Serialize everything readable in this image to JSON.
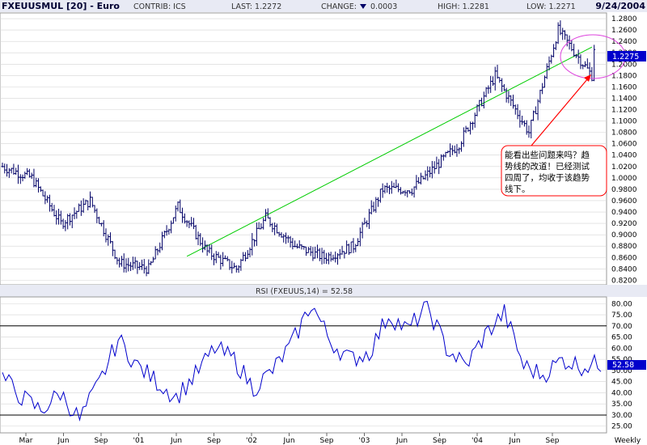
{
  "header": {
    "symbol": "FXEUUSMUL [20] - Euro",
    "contrib": "CONTRIB: ICS",
    "last": "LAST: 1.2272",
    "change_label": "CHANGE:",
    "change_value": "0.0003",
    "high": "HIGH: 1.2281",
    "low": "LOW: 1.2271",
    "date": "9/24/2004"
  },
  "annotation": {
    "lines": [
      "能看出些问题来吗？趋",
      "势线的改道！已经测试",
      "四周了，均收于该趋势",
      "线下。"
    ]
  },
  "colors": {
    "price": "#000066",
    "rsi": "#0000cc",
    "trendline": "#00cc00",
    "arrow": "#ff0000",
    "ellipse": "#dd44dd",
    "grid": "#d4d4d4",
    "last_box": "#0000cc"
  },
  "chart_data": [
    {
      "type": "bar",
      "subtype": "ohlc-weekly",
      "title": "FXEUUSMUL [20] - Euro",
      "yticks": [
        "1.2800",
        "1.2600",
        "1.2400",
        "1.2200",
        "1.2000",
        "1.1800",
        "1.1600",
        "1.1400",
        "1.1200",
        "1.1000",
        "1.0800",
        "1.0600",
        "1.0400",
        "1.0200",
        "1.0000",
        "0.9800",
        "0.9600",
        "0.9400",
        "0.9200",
        "0.9000",
        "0.8800",
        "0.8600",
        "0.8400",
        "0.8200"
      ],
      "ylim": [
        0.812,
        1.29
      ],
      "last_value": "1.2275",
      "x_ticks": [
        "Mar",
        "Jun",
        "Sep",
        "'01",
        "Jun",
        "Sep",
        "'02",
        "Jun",
        "Sep",
        "'03",
        "Jun",
        "Sep",
        "'04",
        "Jun",
        "Sep",
        "Weekly"
      ],
      "x_points": [
        0,
        13,
        26,
        39,
        52,
        65,
        78,
        91,
        104,
        117,
        130,
        143,
        156,
        169,
        182,
        203,
        219,
        234,
        247,
        262
      ],
      "y_values": [
        1.02,
        1.0,
        0.92,
        0.96,
        0.85,
        0.84,
        0.95,
        0.87,
        0.84,
        0.93,
        0.88,
        0.86,
        0.88,
        0.98,
        0.98,
        1.06,
        1.18,
        1.08,
        1.26,
        1.18,
        1.23
      ],
      "trendline": {
        "from": {
          "week": 82,
          "value": 0.862
        },
        "to": {
          "week": 262,
          "value": 1.23
        }
      },
      "grid": true
    },
    {
      "type": "line",
      "title": "RSI (FXEUUS,14) = 52.58",
      "yticks": [
        "80.00",
        "75.00",
        "70.00",
        "65.00",
        "60.00",
        "55.00",
        "50.00",
        "45.00",
        "40.00",
        "35.00",
        "30.00",
        "25.00"
      ],
      "ylim": [
        22,
        83
      ],
      "reference_lines": [
        70,
        30
      ],
      "last_value": "52.58",
      "x_points": [
        0,
        6,
        12,
        18,
        24,
        30,
        36,
        42,
        48,
        54,
        60,
        66,
        72,
        78,
        84,
        90,
        96,
        102,
        108,
        114,
        120,
        126,
        132,
        138,
        144,
        150,
        156,
        162,
        168,
        174,
        180,
        186
      ],
      "y_values": [
        47,
        38,
        32,
        40,
        28,
        44,
        64,
        52,
        45,
        38,
        48,
        60,
        55,
        42,
        50,
        62,
        80,
        63,
        55,
        58,
        75,
        68,
        79,
        60,
        52,
        66,
        76,
        52,
        48,
        55,
        52,
        53
      ],
      "grid": true
    }
  ]
}
